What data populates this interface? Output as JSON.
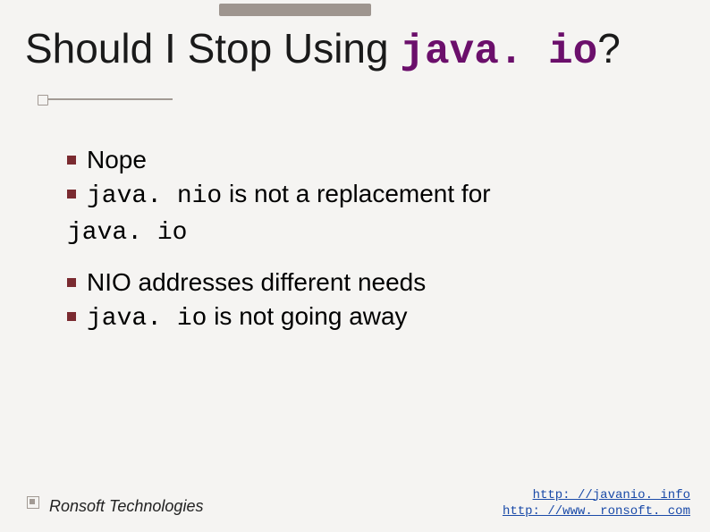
{
  "title": {
    "prefix": "Should I Stop Using ",
    "code": "java. io",
    "suffix": "?"
  },
  "bullets": [
    {
      "type": "bullet",
      "parts": [
        {
          "t": "Nope",
          "code": false
        }
      ]
    },
    {
      "type": "bullet",
      "parts": [
        {
          "t": "java. nio",
          "code": true
        },
        {
          "t": " is not a replacement for",
          "code": false
        }
      ]
    },
    {
      "type": "cont",
      "parts": [
        {
          "t": "java. io",
          "code": true
        }
      ]
    },
    {
      "type": "gap"
    },
    {
      "type": "bullet",
      "parts": [
        {
          "t": "NIO addresses different needs",
          "code": false
        }
      ]
    },
    {
      "type": "bullet",
      "parts": [
        {
          "t": "java. io",
          "code": true
        },
        {
          "t": " is not going away",
          "code": false
        }
      ]
    }
  ],
  "footer": {
    "company": "Ronsoft Technologies",
    "links": [
      "http: //javanio. info",
      "http: //www. ronsoft. com"
    ]
  }
}
